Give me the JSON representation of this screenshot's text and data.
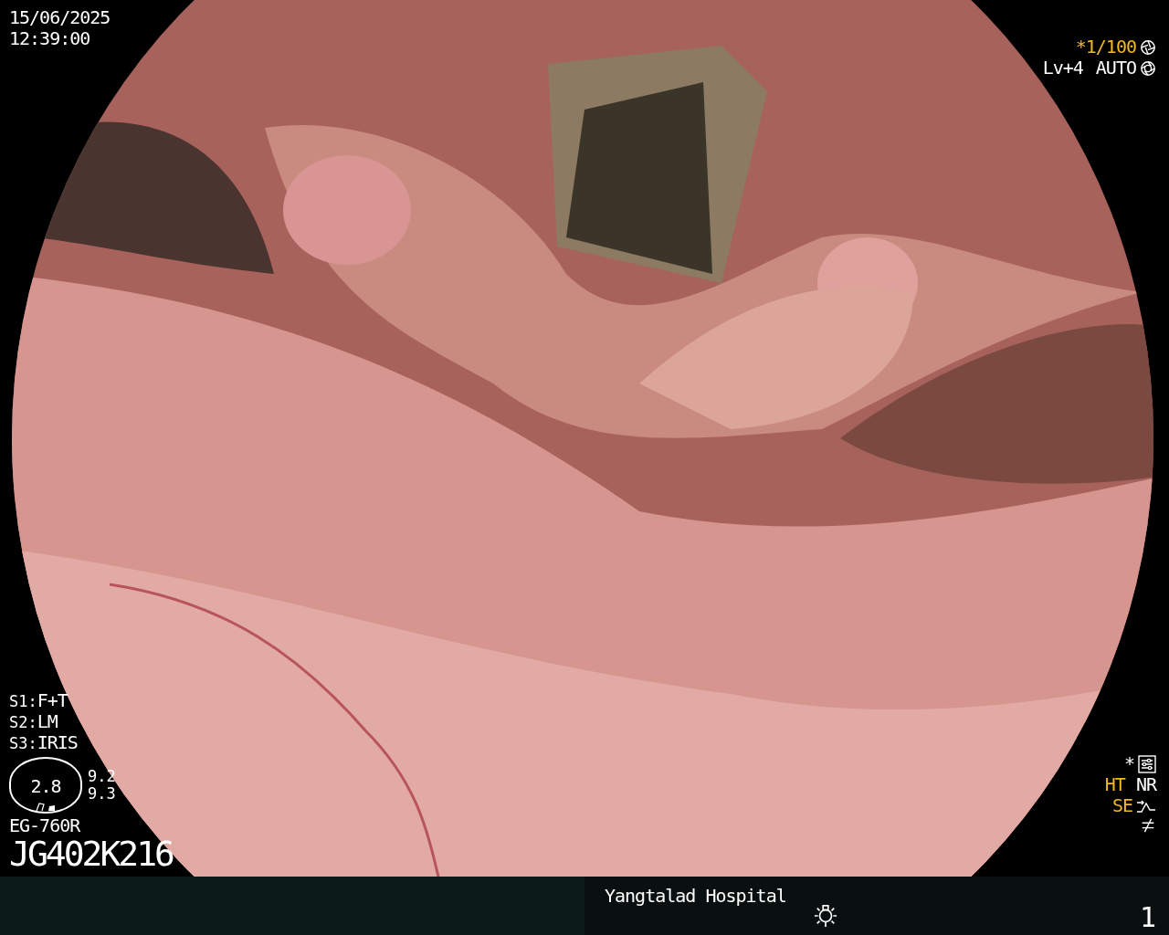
{
  "datetime": {
    "date": "15/06/2025",
    "time": "12:39:00"
  },
  "exposure": {
    "shutter": "*1/100",
    "level": "Lv+4",
    "mode": "AUTO"
  },
  "settings": [
    {
      "label": "S1:",
      "value": "F+T"
    },
    {
      "label": "S2:",
      "value": "LM"
    },
    {
      "label": "S3:",
      "value": "IRIS"
    }
  ],
  "zoom_gauge": {
    "value": "2.8",
    "readings": [
      "9.2",
      "9.3"
    ]
  },
  "scope": {
    "model": "EG-760R",
    "serial": "JG402K216"
  },
  "enhancements": {
    "marker": "*",
    "modes": [
      {
        "text": "HT",
        "color": "#f5b820"
      },
      {
        "text": "NR",
        "color": "#ffffff"
      }
    ],
    "structure": {
      "text": "SE",
      "color": "#f5b820"
    }
  },
  "footer": {
    "hospital": "Yangtalad Hospital",
    "page": "1"
  }
}
